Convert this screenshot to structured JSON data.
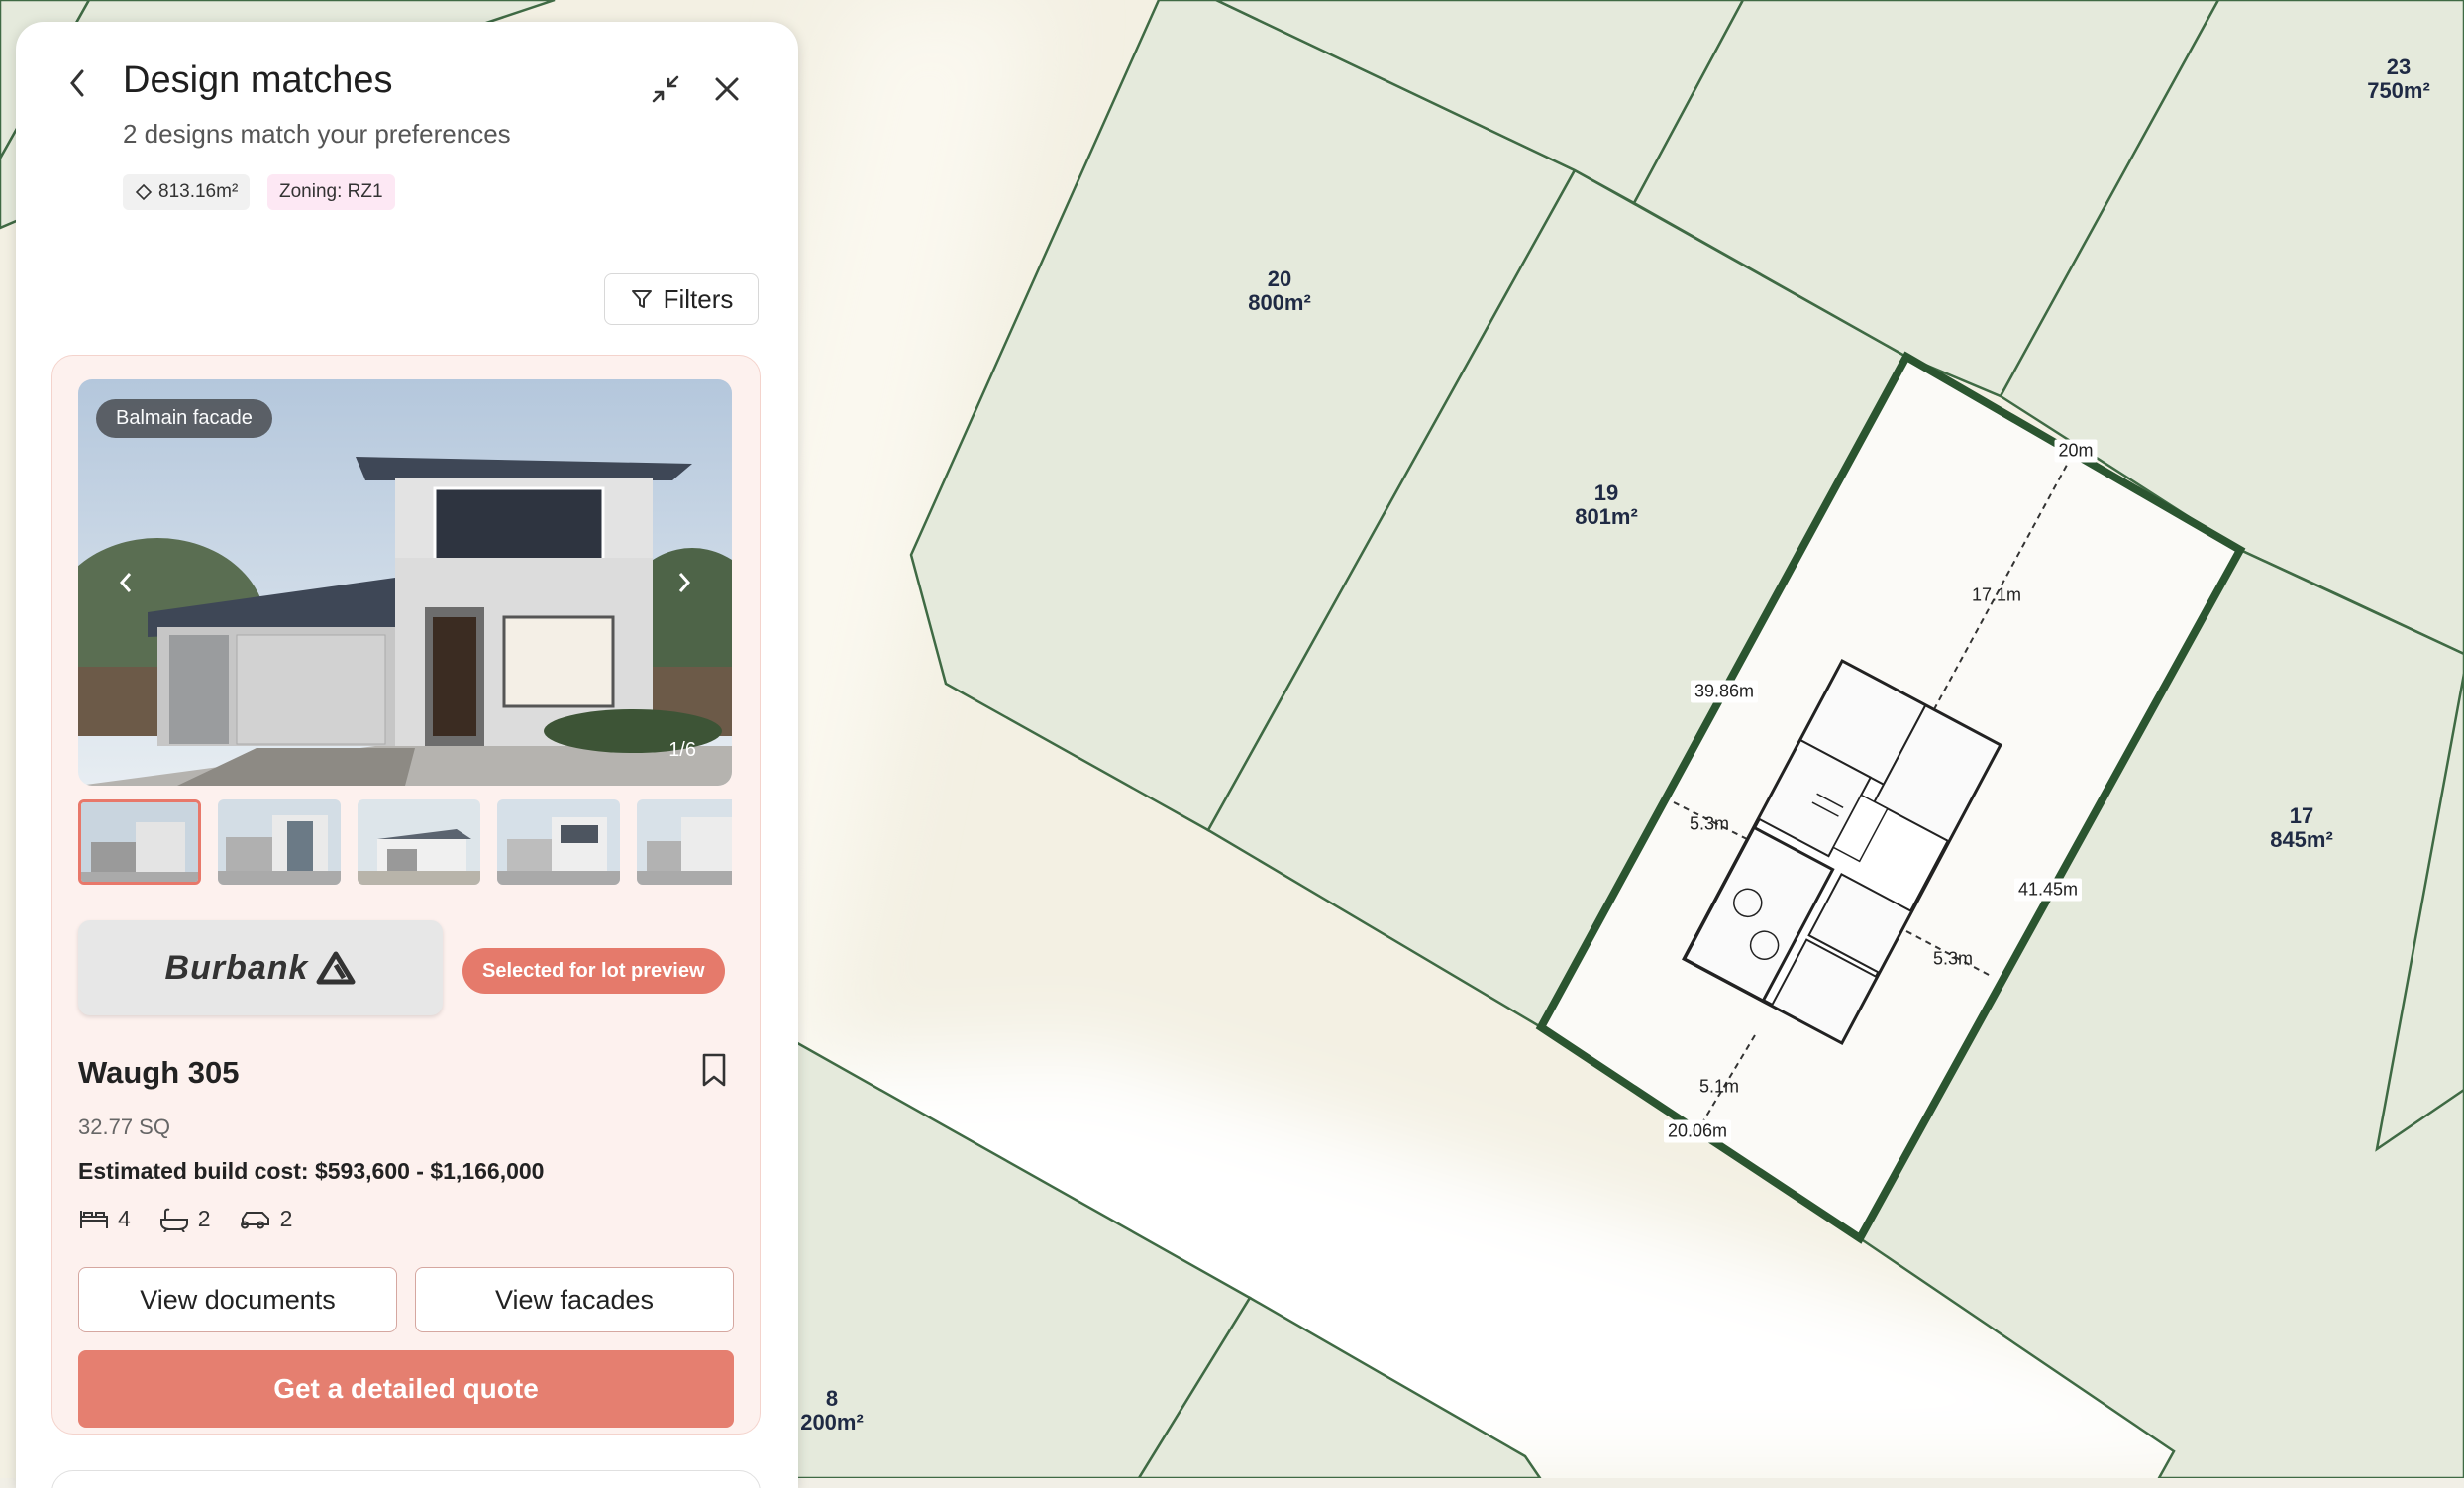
{
  "panel": {
    "title": "Design matches",
    "subtitle": "2 designs match your preferences",
    "chips": {
      "area": "813.16m²",
      "zoning": "Zoning: RZ1"
    },
    "filters_label": "Filters"
  },
  "design": {
    "facade_badge": "Balmain facade",
    "image_counter": "1/6",
    "builder": "Burbank",
    "selected_badge": "Selected for lot preview",
    "name": "Waugh 305",
    "size": "32.77 SQ",
    "build_cost": "Estimated build cost: $593,600 - $1,166,000",
    "bedrooms": "4",
    "bathrooms": "2",
    "garages": "2",
    "view_documents": "View documents",
    "view_facades": "View facades",
    "quote_button": "Get a detailed quote"
  },
  "map": {
    "lots": [
      {
        "number": "23",
        "area": "750m²"
      },
      {
        "number": "20",
        "area": "800m²"
      },
      {
        "number": "19",
        "area": "801m²"
      },
      {
        "number": "17",
        "area": "845m²"
      },
      {
        "number": "8",
        "area": "200m²"
      }
    ],
    "dimensions": {
      "front_width": "20m",
      "rear_width": "20.06m",
      "left_side": "39.86m",
      "right_side": "41.45m",
      "front_setback": "17.1m",
      "side_setback_left": "5.3m",
      "side_setback_right": "5.3m",
      "rear_setback": "5.1m"
    },
    "colors": {
      "lot_fill": "#e6eadc",
      "lot_border": "#3f6a44",
      "selected_border": "#2b5530",
      "road": "#ffffff"
    }
  }
}
